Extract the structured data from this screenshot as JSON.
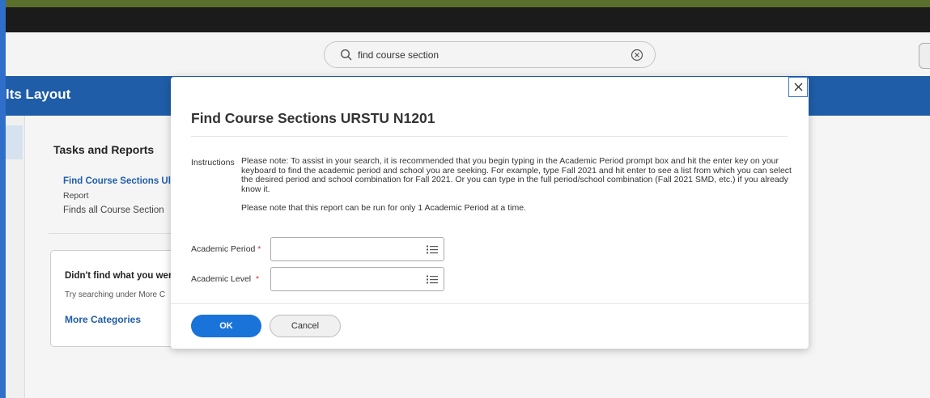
{
  "header": {
    "search_value": "find course section"
  },
  "page": {
    "title": "lts Layout"
  },
  "tasks": {
    "title": "Tasks and Reports",
    "link": "Find Course Sections Ul",
    "type": "Report",
    "description": "Finds all Course Section"
  },
  "didnt_find": {
    "title": "Didn't find what you wer",
    "subtitle": "Try searching under More C",
    "link": "More Categories"
  },
  "modal": {
    "title": "Find Course Sections URSTU N1201",
    "instructions_label": "Instructions",
    "instructions_p1": "Please note: To assist in your search, it is recommended that you begin typing in the Academic Period prompt box and hit the enter key on your keyboard to find the academic period and school you are seeking.  For example, type Fall 2021 and hit enter to see a list from which you can select the desired period and school combination for Fall 2021.  Or you can type in the full period/school combination (Fall 2021 SMD, etc.) if you already know it.",
    "instructions_p2": "Please note that this report can be run for only 1 Academic Period at a time.",
    "fields": [
      {
        "label": "Academic Period",
        "required": "*",
        "value": ""
      },
      {
        "label": "Academic Level",
        "required": "*",
        "value": ""
      }
    ],
    "ok_label": "OK",
    "cancel_label": "Cancel"
  },
  "colors": {
    "brand_blue": "#1f5da8",
    "primary_button": "#1a73d9",
    "required": "#d8313a"
  },
  "icons": [
    "search-icon",
    "clear-icon",
    "close-icon",
    "list-icon"
  ]
}
